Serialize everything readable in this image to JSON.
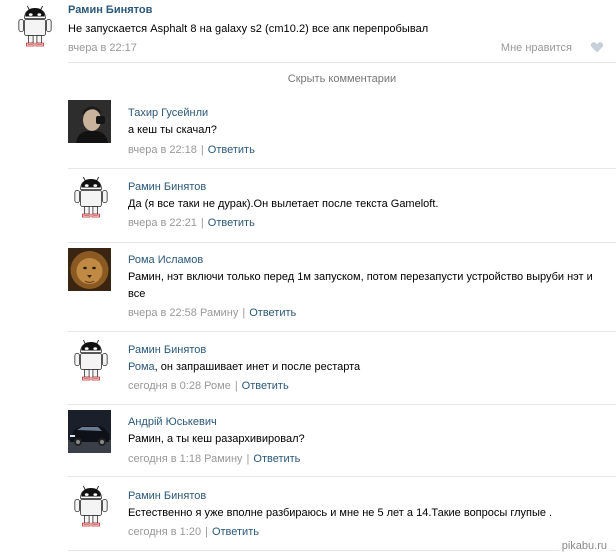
{
  "post": {
    "author": "Рамин Бинятов",
    "text": "Не запускается Asphalt 8 на galaxy s2 (cm10.2) все апк перепробывал",
    "date": "вчера в 22:17",
    "like_label": "Мне нравится"
  },
  "hide_comments_label": "Скрыть комментарии",
  "reply_label": "Ответить",
  "comments": [
    {
      "author": "Тахир Гусейнли",
      "text": "а кеш ты скачал?",
      "date": "вчера в 22:18",
      "reply_to": ""
    },
    {
      "author": "Рамин Бинятов",
      "text": "Да (я все таки не дурак).Он вылетает после текста Gameloft.",
      "date": "вчера в 22:21",
      "reply_to": ""
    },
    {
      "author": "Рома Исламов",
      "text": "Рамин, нэт включи только перед 1м запуском, потом перезапусти устройство выруби нэт и все",
      "date": "вчера в 22:58",
      "reply_to": "Рамину"
    },
    {
      "author": "Рамин Бинятов",
      "text_link": "Рома",
      "text": ", он запрашивает инет и после рестарта",
      "date": "сегодня в 0:28",
      "reply_to": "Роме"
    },
    {
      "author": "Андрій Юськевич",
      "text": "Рамин, а ты кеш разархивировал?",
      "date": "сегодня в 1:18",
      "reply_to": "Рамину"
    },
    {
      "author": "Рамин Бинятов",
      "text": "Естественно я уже вполне разбираюсь и мне не 5 лет а 14.Такие вопросы глупые .",
      "date": "сегодня в 1:20",
      "reply_to": ""
    }
  ],
  "watermark": "pikabu.ru",
  "icons": [
    "android-avatar-icon",
    "heart-icon"
  ]
}
